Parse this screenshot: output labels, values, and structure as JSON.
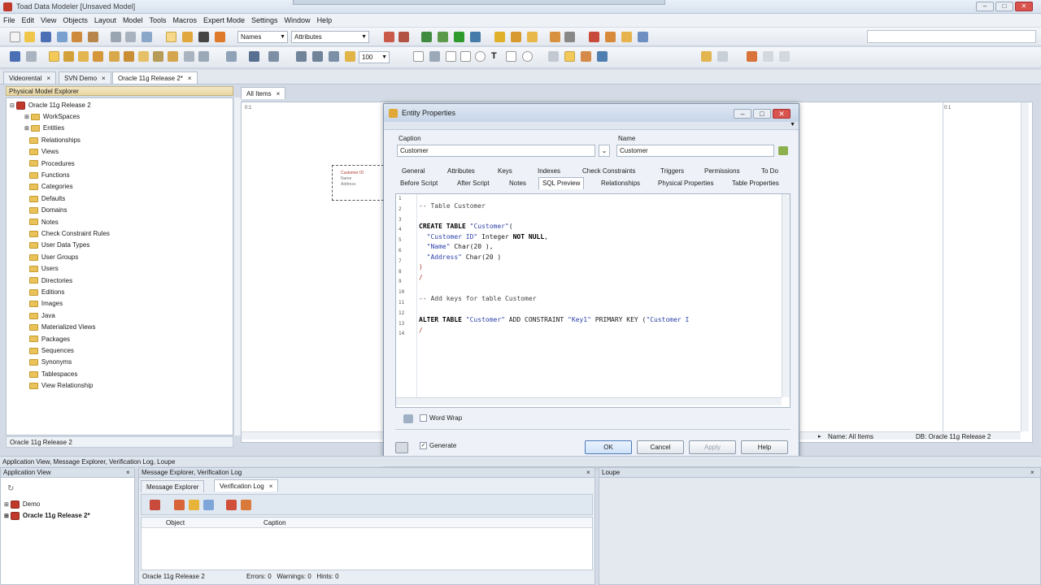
{
  "window": {
    "title": "Toad Data Modeler [Unsaved Model]"
  },
  "menu": [
    "File",
    "Edit",
    "View",
    "Objects",
    "Layout",
    "Model",
    "Tools",
    "Macros",
    "Expert Mode",
    "Settings",
    "Window",
    "Help"
  ],
  "toolbar": {
    "names_combo": "Names",
    "attributes_combo": "Attributes",
    "zoom": "100"
  },
  "doc_tabs": [
    {
      "label": "Videorental"
    },
    {
      "label": "SVN Demo"
    },
    {
      "label": "Oracle 11g Release 2*"
    }
  ],
  "explorer": {
    "header": "Physical Model Explorer",
    "root": "Oracle 11g Release 2",
    "items": [
      "WorkSpaces",
      "Entities",
      "Relationships",
      "Views",
      "Procedures",
      "Functions",
      "Categories",
      "Defaults",
      "Domains",
      "Notes",
      "Check Constraint Rules",
      "User Data Types",
      "User Groups",
      "Users",
      "Directories",
      "Editions",
      "Images",
      "Java",
      "Materialized Views",
      "Packages",
      "Sequences",
      "Synonyms",
      "Tablespaces",
      "View Relationship"
    ],
    "status": "Oracle 11g Release 2"
  },
  "canvas": {
    "tab": "All Items",
    "status_name": "Name: All Items",
    "status_db": "DB: Oracle 11g Release 2",
    "entity_title": "Customer ID",
    "entity_rows": [
      "Name",
      "Address"
    ]
  },
  "dialog": {
    "title": "Entity Properties",
    "caption_label": "Caption",
    "caption_value": "Customer",
    "name_label": "Name",
    "name_value": "Customer",
    "tabs_row1": [
      "General",
      "Attributes",
      "Keys",
      "Indexes",
      "Check Constraints",
      "Triggers",
      "Permissions",
      "To Do"
    ],
    "tabs_row2": [
      "Before Script",
      "After Script",
      "Notes",
      "SQL Preview",
      "Relationships",
      "Physical Properties",
      "Table Properties"
    ],
    "active_tab": "SQL Preview",
    "line_numbers": [
      "1",
      "2",
      "3",
      "4",
      "5",
      "6",
      "7",
      "8",
      "9",
      "10",
      "11",
      "12",
      "13",
      "14"
    ],
    "code": {
      "c2": "-- Table Customer",
      "c4a": "CREATE TABLE ",
      "c4b": "\"Customer\"",
      "c4c": "(",
      "c5a": "  \"Customer ID\"",
      "c5b": " Integer ",
      "c5c": "NOT NULL",
      "c5d": ",",
      "c6a": "  \"Name\"",
      "c6b": " Char(20 ),",
      "c7a": "  \"Address\"",
      "c7b": " Char(20 )",
      "c8": ")",
      "c9": "/",
      "c11": "-- Add keys for table Customer",
      "c13a": "ALTER TABLE ",
      "c13b": "\"Customer\"",
      "c13c": " ADD CONSTRAINT ",
      "c13d": "\"Key1\"",
      "c13e": " PRIMARY KEY (",
      "c13f": "\"Customer I",
      "c14": "/"
    },
    "word_wrap_label": "Word Wrap",
    "generate_label": "Generate",
    "buttons": {
      "ok": "OK",
      "cancel": "Cancel",
      "apply": "Apply",
      "help": "Help"
    }
  },
  "bottom": {
    "bar_label": "Application View, Message Explorer, Verification Log, Loupe",
    "app_view": {
      "title": "Application View",
      "items": [
        "Demo",
        "Oracle 11g Release 2*"
      ]
    },
    "message": {
      "title": "Message Explorer, Verification Log",
      "tabs": [
        "Message Explorer",
        "Verification Log"
      ],
      "columns": [
        "Object",
        "Caption"
      ],
      "status_model": "Oracle 11g Release 2",
      "status_counts": "Errors: 0   Warnings: 0   Hints: 0"
    },
    "loupe": {
      "title": "Loupe"
    }
  }
}
